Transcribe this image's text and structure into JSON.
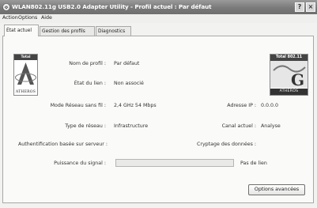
{
  "window": {
    "title": "WLAN802.11g USB2.0 Adapter Utility - Profil actuel : Par défaut",
    "help_glyph": "?",
    "close_glyph": "×"
  },
  "menu": [
    "Action",
    "Options",
    "Aide"
  ],
  "tabs": [
    {
      "label": "État actuel",
      "active": true
    },
    {
      "label": "Gestion des profils",
      "active": false
    },
    {
      "label": "Diagnostics",
      "active": false
    }
  ],
  "logo_left": {
    "line1": "Total 802.11",
    "brand": "ATHEROS"
  },
  "logo_right": {
    "line1": "Total 802.11",
    "brand": "ATHEROS"
  },
  "status": {
    "profile_label": "Nom de profil :",
    "profile_value": "Par défaut",
    "link_label": "État du lien :",
    "link_value": "Non associé",
    "mode_label": "Mode Réseau sans fil :",
    "mode_value": "2,4 GHz 54 Mbps",
    "ip_label": "Adresse IP :",
    "ip_value": "0.0.0.0",
    "network_type_label": "Type de réseau :",
    "network_type_value": "Infrastructure",
    "channel_label": "Canal actuel :",
    "channel_value": "Analyse",
    "auth_label": "Authentification basée sur serveur :",
    "encryption_label": "Cryptage des données :",
    "signal_label": "Puissance du signal :",
    "signal_value": "Pas de lien",
    "signal_level": 0
  },
  "buttons": {
    "advanced": "Options avancées"
  },
  "colors": {
    "titlebar": "#7a7a7a",
    "panel": "#fafaf8",
    "progress": "#6b8fc4"
  }
}
